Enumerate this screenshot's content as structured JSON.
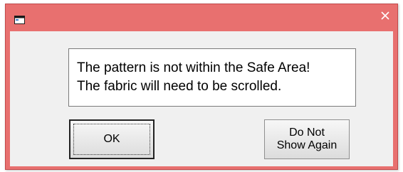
{
  "dialog": {
    "message_lines": [
      "The pattern is not within the Safe Area!",
      "The fabric will need to be scrolled."
    ],
    "ok_label": "OK",
    "dont_show_lines": [
      "Do Not",
      "Show Again"
    ],
    "title_icon": "window-app-icon",
    "close_icon": "close-x-icon"
  },
  "colors": {
    "titlebar": "#e8706f",
    "client": "#f0f0f0"
  }
}
